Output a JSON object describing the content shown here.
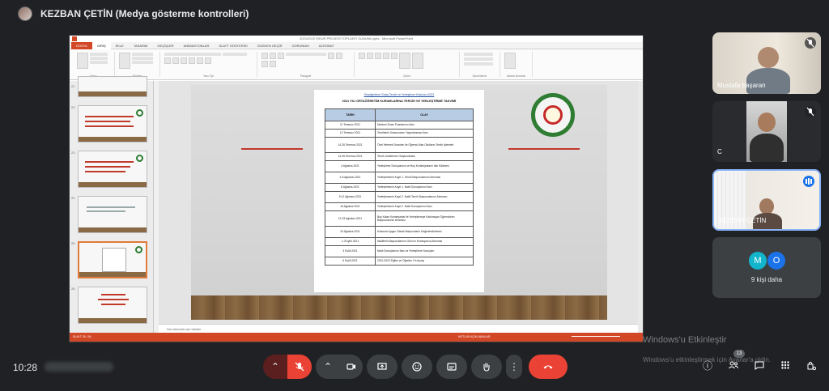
{
  "presenter": {
    "name": "KEZBAN ÇETİN (Medya gösterme kontrolleri)"
  },
  "ppt": {
    "window_title": "2021/2022 İŞKUR PROJESİ TOPLANTI SUNUMU.pptx - Microsoft PowerPoint",
    "tabs": [
      "DOSYA",
      "GİRİŞ",
      "EKLE",
      "TASARIM",
      "GEÇİŞLER",
      "ANİMASYONLAR",
      "SLAYT GÖSTERİSİ",
      "GÖZDEN GEÇİR",
      "GÖRÜNÜM",
      "ACROBAT"
    ],
    "ribbon_groups": [
      "Pano",
      "Slaytlar",
      "Yazı Tipi",
      "Paragraf",
      "Çizim",
      "Düzenleme",
      "Adobe Acrobat"
    ],
    "thumbnail_numbers": [
      "21",
      "22",
      "23",
      "24",
      "25",
      "26"
    ],
    "notes_placeholder": "Not eklemek için tıklatın",
    "status_left": "SLAYT 25 / 26",
    "status_right": "NOTLAR   AÇIKLAMALAR"
  },
  "slide_doc": {
    "link": "Ortaöğretime Geçiş Tercih ve Yerleştirme Kılavuzu 2021",
    "title": "2021 YILI ORTAÖĞRETİM KURUMLARINA TERCİH VE YERLEŞTİRME TAKVİMİ",
    "columns": [
      "TARİH",
      "OLAY"
    ],
    "rows": [
      [
        "11 Temmuz 2021",
        "Merkezi Sınav Puanlarının İlanı"
      ],
      [
        "12 Temmuz 2021",
        "Tercihlerin Kılavuzunun Yayımlanması İlanı"
      ],
      [
        "14-26 Temmuz 2021",
        "Özel Yetenek Sınavları ile Öğrenci Alan Okulların Tercih İşlemleri"
      ],
      [
        "14-26 Temmuz 2021",
        "Tercih Listelerinin Oluşturulması"
      ],
      [
        "4 Ağustos 2021",
        "Yerleştirme Sonuçlarının ve Boş Kontenjanların İlan Edilmesi"
      ],
      [
        "4-6 Ağustos 2021",
        "Yerleştirmenin Kayıt 1. Tercih Başvurularının Alınması"
      ],
      [
        "6 Ağustos 2021",
        "Yerleştirmenin Kayıt 1. Nakil Sonuçlarının İlanı"
      ],
      [
        "9-12 Ağustos 2021",
        "Yerleştirmenin Kayıt 2. Nakil Tercih Başvurularının Alınması"
      ],
      [
        "16 Ağustos 2021",
        "Yerleştirmenin Kayıt 2. Nakil Sonuçlarının İlanı"
      ],
      [
        "12-23 Ağustos 2021",
        "Boş Kalan Kontenjanlar ile Yerleştirmeye Katılmayan Öğrencilerin Başvurularının Alınması"
      ],
      [
        "23 Ağustos 2021",
        "Kılavuza Uygun Olarak Başvuruların Değerlendirilmesi"
      ],
      [
        "1-3 Eylül 2021",
        "Nakillerin Başvurularının Okul ve Komisyonca Alınması"
      ],
      [
        "3 Eylül 2021",
        "Nakil Sonuçlarının İlanı ve Yerleştirme Sonuçları"
      ],
      [
        "6 Eylül 2021",
        "2021-2022 Eğitim ve Öğretim Yılı Açılışı"
      ]
    ]
  },
  "participants": [
    {
      "name": "Mustafa başaran",
      "muted": true
    },
    {
      "name": "C",
      "muted": true
    },
    {
      "name": "KEZBAN ÇETİN",
      "speaking": true
    }
  ],
  "more_tile": {
    "avatars": [
      {
        "letter": "M",
        "color": "#12b5cb"
      },
      {
        "letter": "O",
        "color": "#1a73e8"
      }
    ],
    "label": "9 kişi daha"
  },
  "bottom": {
    "time": "10:28",
    "participant_count": "13",
    "watermark_title": "Windows'u Etkinleştir",
    "watermark_sub": "Windows'u etkinleştirmek için Ayarlar'a gidin."
  },
  "colors": {
    "accent": "#8ab4f8",
    "end_call": "#ea4335",
    "ppt_orange": "#d24726"
  }
}
